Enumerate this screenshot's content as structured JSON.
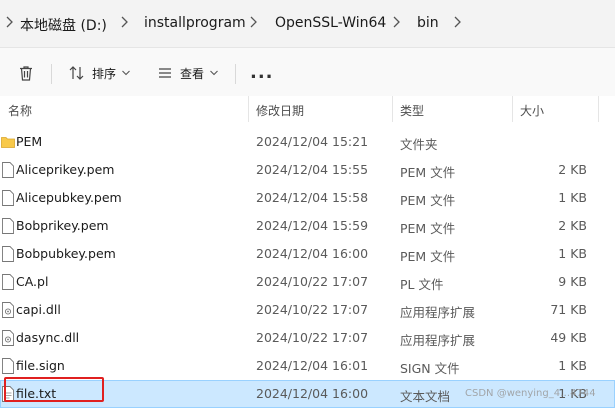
{
  "breadcrumb": {
    "segments": [
      "本地磁盘 (D:)",
      "installprogram",
      "OpenSSL-Win64",
      "bin"
    ]
  },
  "toolbar": {
    "sort_label": "排序",
    "view_label": "查看",
    "more_label": "..."
  },
  "columns": {
    "name": "名称",
    "date": "修改日期",
    "type": "类型",
    "size": "大小"
  },
  "files": [
    {
      "name": "PEM",
      "date": "2024/12/04 15:21",
      "type": "文件夹",
      "size": "",
      "icon": "folder-icon"
    },
    {
      "name": "Aliceprikey.pem",
      "date": "2024/12/04 15:55",
      "type": "PEM 文件",
      "size": "2 KB",
      "icon": "file-icon"
    },
    {
      "name": "Alicepubkey.pem",
      "date": "2024/12/04 15:58",
      "type": "PEM 文件",
      "size": "1 KB",
      "icon": "file-icon"
    },
    {
      "name": "Bobprikey.pem",
      "date": "2024/12/04 15:59",
      "type": "PEM 文件",
      "size": "2 KB",
      "icon": "file-icon"
    },
    {
      "name": "Bobpubkey.pem",
      "date": "2024/12/04 16:00",
      "type": "PEM 文件",
      "size": "1 KB",
      "icon": "file-icon"
    },
    {
      "name": "CA.pl",
      "date": "2024/10/22 17:07",
      "type": "PL 文件",
      "size": "9 KB",
      "icon": "file-icon"
    },
    {
      "name": "capi.dll",
      "date": "2024/10/22 17:07",
      "type": "应用程序扩展",
      "size": "71 KB",
      "icon": "dll-icon"
    },
    {
      "name": "dasync.dll",
      "date": "2024/10/22 17:07",
      "type": "应用程序扩展",
      "size": "49 KB",
      "icon": "dll-icon"
    },
    {
      "name": "file.sign",
      "date": "2024/12/04 16:01",
      "type": "SIGN 文件",
      "size": "1 KB",
      "icon": "file-icon"
    },
    {
      "name": "file.txt",
      "date": "2024/12/04 16:00",
      "type": "文本文档",
      "size": "1 KB",
      "icon": "text-file-icon",
      "selected": true
    }
  ],
  "watermark": "CSDN @wenying_4…4744",
  "colors": {
    "selection": "#cce8ff",
    "folder": "#f8c94a",
    "highlight_box": "#e02020"
  }
}
